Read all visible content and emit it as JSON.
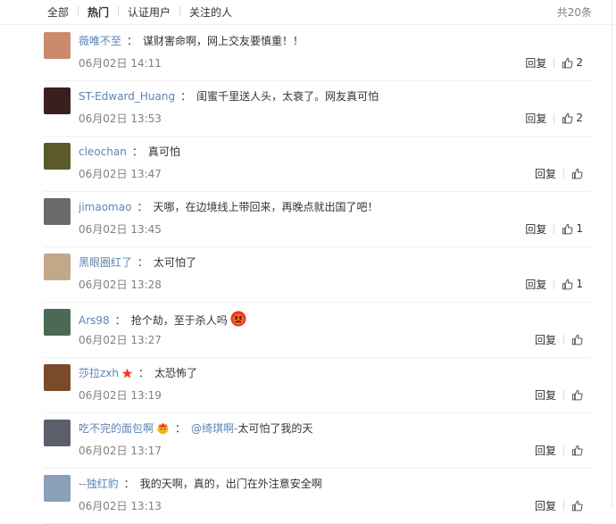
{
  "filters": [
    "全部",
    "热门",
    "认证用户",
    "关注的人"
  ],
  "active_filter_index": 1,
  "total": "共20条",
  "comments": [
    {
      "user": "薇唯不至",
      "text": "谋财害命啊，网上交友要慎重！！",
      "time": "06月02日 14:11",
      "reply": "回复",
      "likes": "2",
      "avatar": "#c98b6b"
    },
    {
      "user": "ST-Edward_Huang",
      "text": "闺蜜千里送人头，太衰了。网友真可怕",
      "time": "06月02日 13:53",
      "reply": "回复",
      "likes": "2",
      "avatar": "#3a1f1f"
    },
    {
      "user": "cleochan",
      "text": "真可怕",
      "time": "06月02日 13:47",
      "reply": "回复",
      "likes": "",
      "avatar": "#5a5a2a"
    },
    {
      "user": "jimaomao",
      "text": "天哪，在边境线上带回来，再晚点就出国了吧！",
      "time": "06月02日 13:45",
      "reply": "回复",
      "likes": "1",
      "avatar": "#6a6a6a"
    },
    {
      "user": "黑眼圈红了",
      "text": "太可怕了",
      "time": "06月02日 13:28",
      "reply": "回复",
      "likes": "1",
      "avatar": "#c2a889"
    },
    {
      "user": "Ars98",
      "text": "抢个劫，至于杀人吗",
      "time": "06月02日 13:27",
      "reply": "回复",
      "likes": "",
      "avatar": "#4b6a55"
    },
    {
      "user": "莎拉zxh",
      "text": "太恐怖了",
      "time": "06月02日 13:19",
      "reply": "回复",
      "likes": "",
      "avatar": "#7a4a2a"
    },
    {
      "user": "吃不完的面包啊",
      "mention": "@绮琪啊-",
      "text": "太可怕了我的天",
      "time": "06月02日 13:17",
      "reply": "回复",
      "likes": "",
      "avatar": "#5b5f6a"
    },
    {
      "user": "--独红豹",
      "text": "我的天啊，真的，出门在外注意安全啊",
      "time": "06月02日 13:13",
      "reply": "回复",
      "likes": "",
      "avatar": "#8aa0b8"
    }
  ]
}
